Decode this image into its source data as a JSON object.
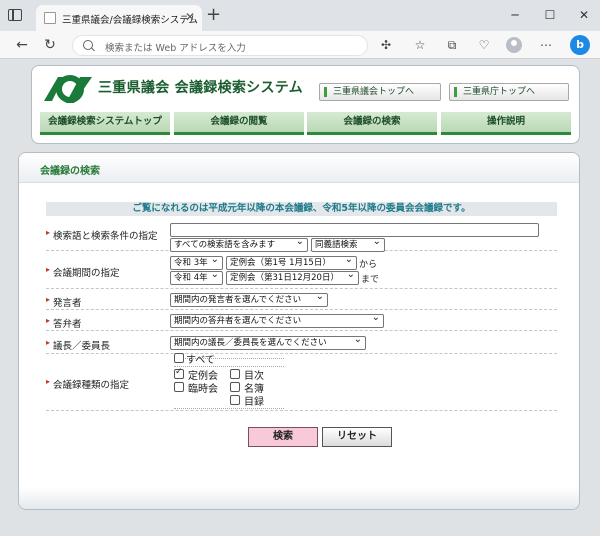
{
  "browser": {
    "tab_title": "三重県議会/会議録検索システム",
    "address_placeholder": "検索または Web アドレスを入力"
  },
  "header": {
    "site_title": "三重県議会 会議録検索システム",
    "assembly_top_button": "三重県議会トップへ",
    "prefecture_top_button": "三重県庁トップへ",
    "logo_color": "#1a7a3a"
  },
  "nav": {
    "items": [
      {
        "label": "会議録検索システムトップ"
      },
      {
        "label": "会議録の閲覧"
      },
      {
        "label": "会議録の検索"
      },
      {
        "label": "操作説明"
      }
    ]
  },
  "panel": {
    "title": "会議録の検索",
    "notice": "ご覧になれるのは平成元年以降の本会議録、令和5年以降の委員会会議録です。"
  },
  "form": {
    "keyword": {
      "label": "検索語と検索条件の指定",
      "value": "",
      "condition": "すべての検索語を含みます",
      "synonym": "同義語検索"
    },
    "period": {
      "label": "会議期間の指定",
      "from_year": "令和 3年",
      "from_session": "定例会（第1号 1月15日）",
      "from_suffix": "から",
      "to_year": "令和 4年",
      "to_session": "定例会（第31日12月20日）",
      "to_suffix": "まで"
    },
    "speaker": {
      "label": "発言者",
      "value": "期間内の発言者を選んでください"
    },
    "respondent": {
      "label": "答弁者",
      "value": "期間内の答弁者を選んでください"
    },
    "chair": {
      "label": "議長／委員長",
      "value": "期間内の議長／委員長を選んでください"
    },
    "record_type": {
      "label": "会議録種類の指定",
      "all": {
        "label": "すべて",
        "checked": false
      },
      "options": [
        {
          "label": "定例会",
          "checked": true
        },
        {
          "label": "臨時会",
          "checked": false
        },
        {
          "label": "目次",
          "checked": false
        },
        {
          "label": "名簿",
          "checked": false
        },
        {
          "label": "目録",
          "checked": false
        }
      ]
    }
  },
  "buttons": {
    "search": "検索",
    "reset": "リセット"
  }
}
